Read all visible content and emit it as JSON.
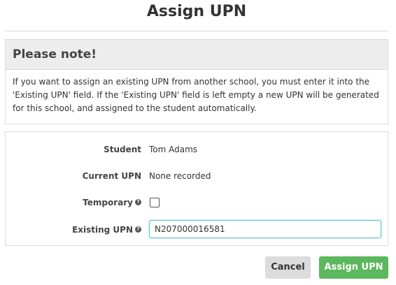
{
  "dialog": {
    "title": "Assign UPN"
  },
  "note": {
    "heading": "Please note!",
    "body": "If you want to assign an existing UPN from another school, you must enter it into the 'Existing UPN' field. If the 'Existing UPN' field is left empty a new UPN will be generated for this school, and assigned to the student automatically."
  },
  "form": {
    "student_label": "Student",
    "student_value": "Tom Adams",
    "current_upn_label": "Current UPN",
    "current_upn_value": "None recorded",
    "temporary_label": "Temporary",
    "temporary_checked": false,
    "existing_upn_label": "Existing UPN",
    "existing_upn_value": "N207000016581",
    "help_icon": "question-circle-icon"
  },
  "actions": {
    "cancel_label": "Cancel",
    "assign_label": "Assign UPN"
  },
  "colors": {
    "assign_button": "#5cb85c",
    "cancel_button": "#dcdcdc",
    "input_focus_border": "#5bc0de",
    "note_header_bg": "#ededed"
  }
}
